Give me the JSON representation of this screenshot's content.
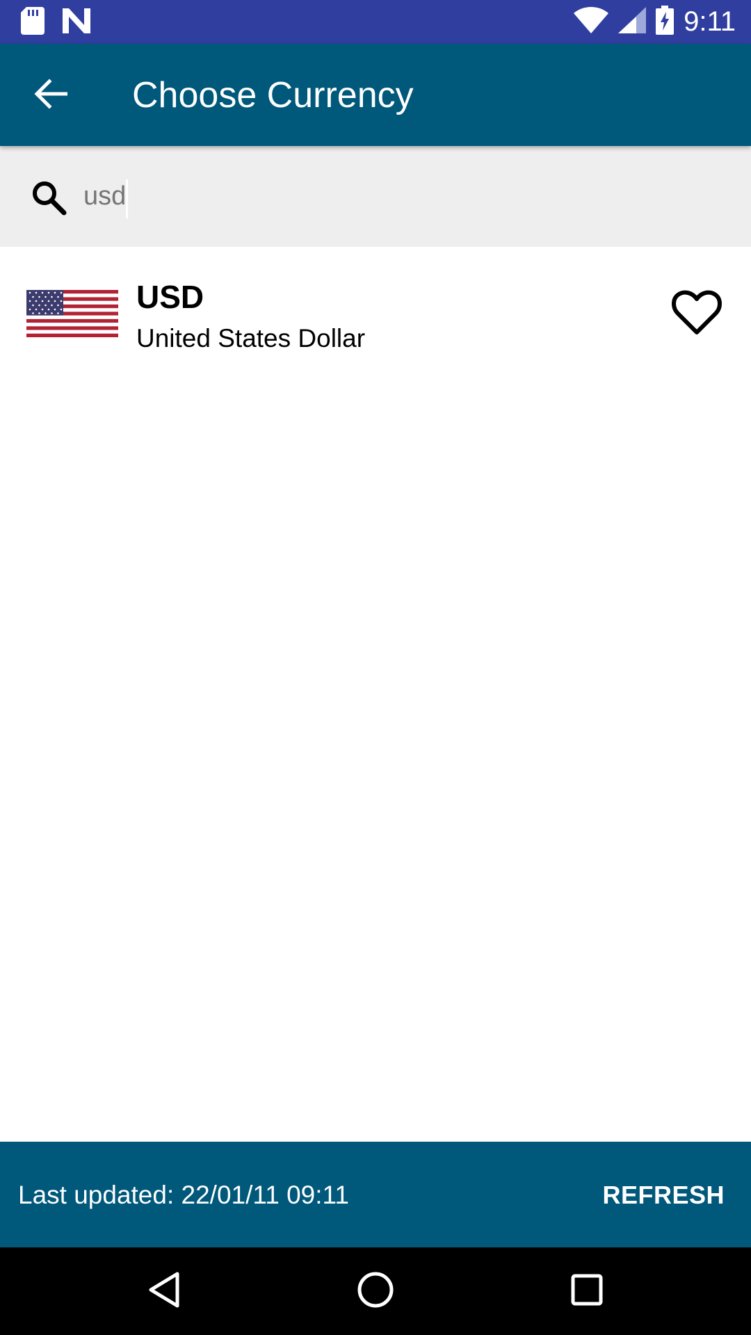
{
  "status_bar": {
    "time": "9:11",
    "icons": [
      "sd-card-icon",
      "n-notification-icon",
      "wifi-icon",
      "cell-signal-icon",
      "battery-charging-icon"
    ]
  },
  "app_bar": {
    "title": "Choose Currency",
    "background": "#00587A"
  },
  "search": {
    "value": "usd",
    "background": "#EEEEEE"
  },
  "currencies": [
    {
      "code": "USD",
      "name": "United States Dollar",
      "flag": "us-flag-icon",
      "favorite": false
    }
  ],
  "footer": {
    "last_updated": "Last updated: 22/01/11 09:11",
    "refresh_label": "REFRESH"
  },
  "nav_bar": {
    "buttons": [
      "back-triangle-icon",
      "home-circle-icon",
      "recents-square-icon"
    ]
  },
  "colors": {
    "status_bar": "#303F9F",
    "primary": "#00587A"
  }
}
